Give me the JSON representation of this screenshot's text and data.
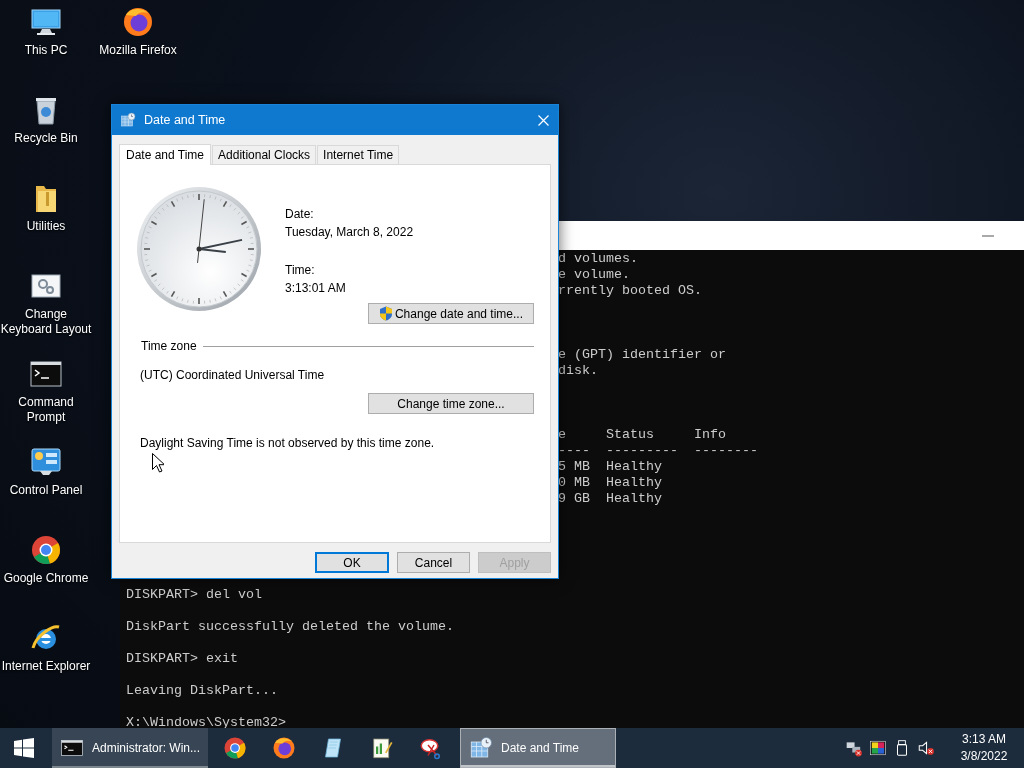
{
  "desktop": {
    "shortcut_columns": [
      [
        {
          "kind": "computer",
          "label": "This PC"
        },
        {
          "kind": "recycle_bin",
          "label": "Recycle Bin"
        },
        {
          "kind": "folder",
          "label": "Utilities"
        },
        {
          "kind": "keyboard_layout",
          "label": "Change Keyboard Layout"
        },
        {
          "kind": "command_prompt",
          "label": "Command Prompt"
        },
        {
          "kind": "control_panel",
          "label": "Control Panel"
        },
        {
          "kind": "chrome",
          "label": "Google Chrome"
        },
        {
          "kind": "ie",
          "label": "Internet Explorer"
        }
      ],
      [
        {
          "kind": "firefox",
          "label": "Mozilla Firefox"
        }
      ]
    ]
  },
  "console_window": {
    "visible_right_of_dialog": [
      [
        "d volumes.",
        "e volume.",
        "rrently booted OS."
      ],
      [
        "e (GPT) identifier or",
        "disk."
      ],
      [
        "e     Status     Info",
        "----  ---------  --------",
        "5 MB  Healthy",
        "0 MB  Healthy",
        "9 GB  Healthy"
      ]
    ],
    "lines_below_dialog": [
      "DISKPART> del vol",
      "DiskPart successfully deleted the volume.",
      "DISKPART> exit",
      "Leaving DiskPart...",
      "X:\\Windows\\System32>"
    ]
  },
  "dialog": {
    "title": "Date and Time",
    "tabs": [
      {
        "label": "Date and Time",
        "selected": true
      },
      {
        "label": "Additional Clocks",
        "selected": false
      },
      {
        "label": "Internet Time",
        "selected": false
      }
    ],
    "date_label": "Date:",
    "date_value": "Tuesday, March 8, 2022",
    "time_label": "Time:",
    "time_value": "3:13:01 AM",
    "change_date_button": {
      "label": "Change date and time...",
      "uac_shield": true
    },
    "time_zone_heading": "Time zone",
    "time_zone_value": "(UTC) Coordinated Universal Time",
    "change_zone_button": {
      "label": "Change time zone...",
      "uac_shield": false
    },
    "dst_note": "Daylight Saving Time is not observed by this time zone.",
    "buttons": [
      {
        "label": "OK",
        "focused": true,
        "disabled": false
      },
      {
        "label": "Cancel",
        "focused": false,
        "disabled": false
      },
      {
        "label": "Apply",
        "focused": false,
        "disabled": true
      }
    ]
  },
  "taskbar": {
    "items": [
      {
        "kind": "console",
        "label": "Administrator: Win...",
        "open": true,
        "selected": false
      },
      {
        "kind": "chrome",
        "open": false,
        "selected": false
      },
      {
        "kind": "firefox",
        "open": false,
        "selected": false
      },
      {
        "kind": "document",
        "open": false,
        "selected": false
      },
      {
        "kind": "document_pencil",
        "open": false,
        "selected": false
      },
      {
        "kind": "scissors",
        "open": false,
        "selected": false
      },
      {
        "kind": "date_time",
        "label": "Date and Time",
        "open": true,
        "selected": true
      }
    ],
    "tray": [
      {
        "kind": "network_error"
      },
      {
        "kind": "color"
      },
      {
        "kind": "usb"
      },
      {
        "kind": "volume_muted"
      }
    ],
    "clock": {
      "time": "3:13 AM",
      "date": "3/8/2022"
    }
  }
}
